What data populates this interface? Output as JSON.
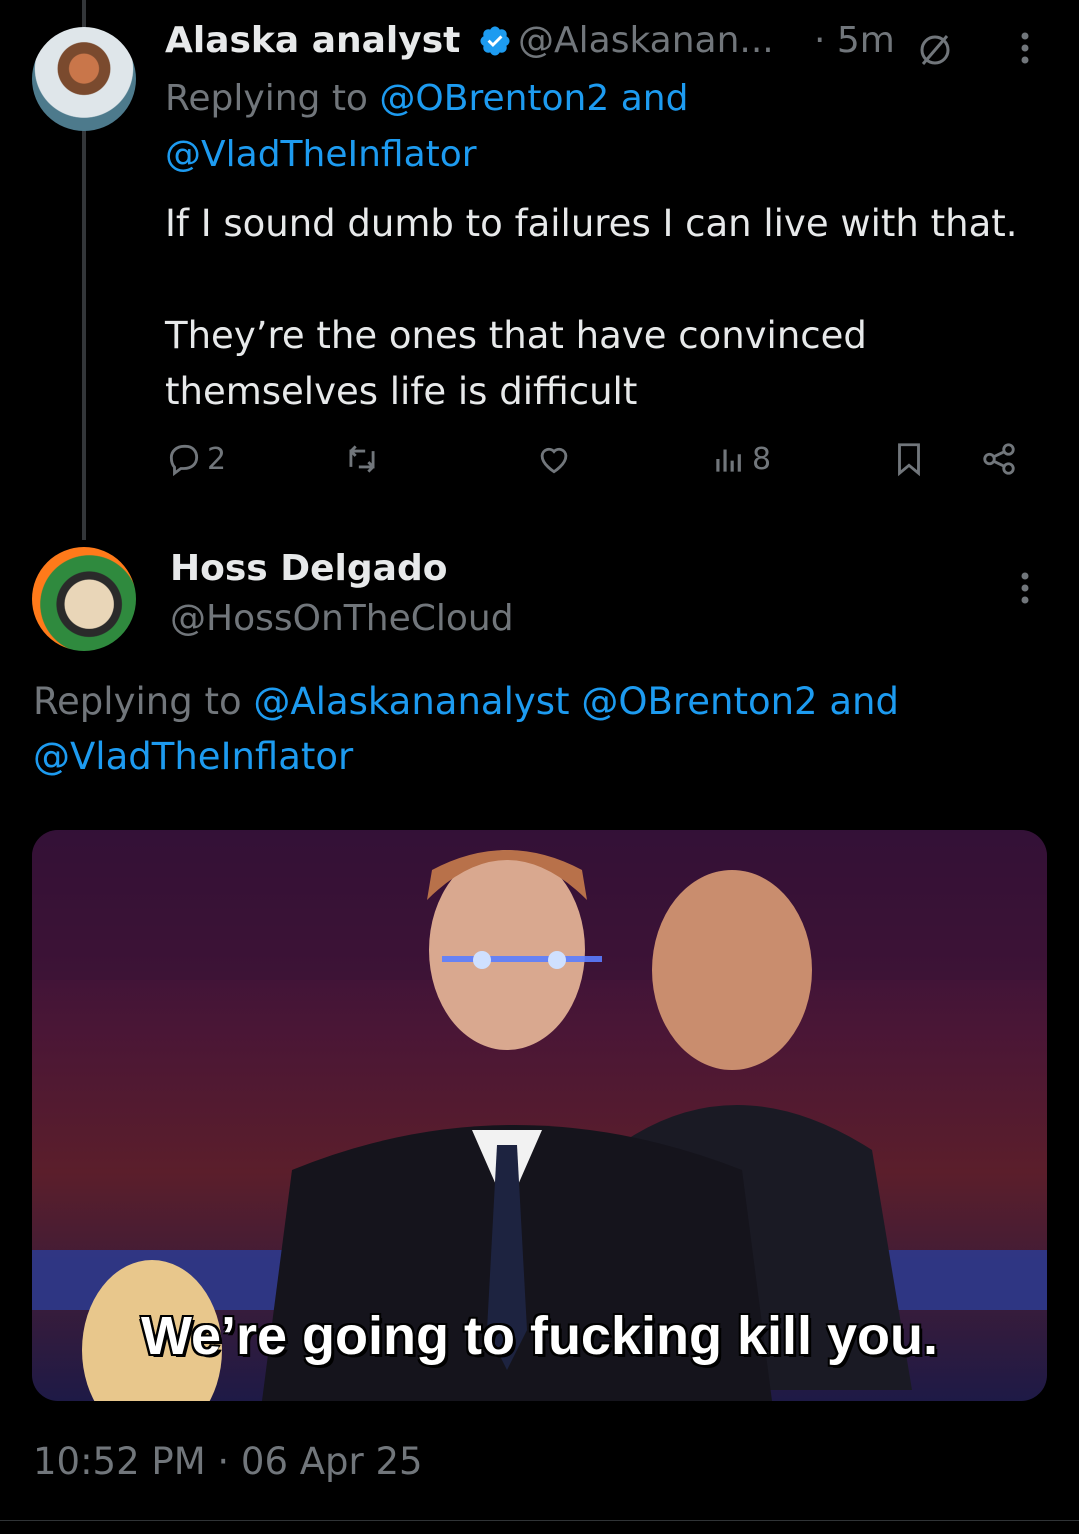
{
  "tweet1": {
    "name": "Alaska analyst",
    "handle": "@Alaskanan...",
    "time": "· 5m",
    "replying_prefix": "Replying to ",
    "replying_to_1": "@OBrenton2",
    "replying_and": " and",
    "replying_to_2": "@VladTheInflator",
    "body": "If I sound dumb to failures I can live with that.\n\nThey’re the ones that have convinced\nthemselves life is difficult",
    "replies": "2",
    "views": "8"
  },
  "tweet2": {
    "name": "Hoss Delgado",
    "handle": "@HossOnTheCloud",
    "replying_prefix": "Replying to ",
    "replying_to_1": "@Alaskananalyst",
    "replying_to_2": "@OBrenton2",
    "replying_and": " and",
    "replying_to_3": "@VladTheInflator",
    "media_caption": "We’re going to fucking kill you.",
    "timestamp": "10:52 PM · 06 Apr 25"
  },
  "colors": {
    "accent": "#1d9bf0",
    "muted": "#71767b",
    "text": "#e7e9ea",
    "background": "#000000"
  }
}
